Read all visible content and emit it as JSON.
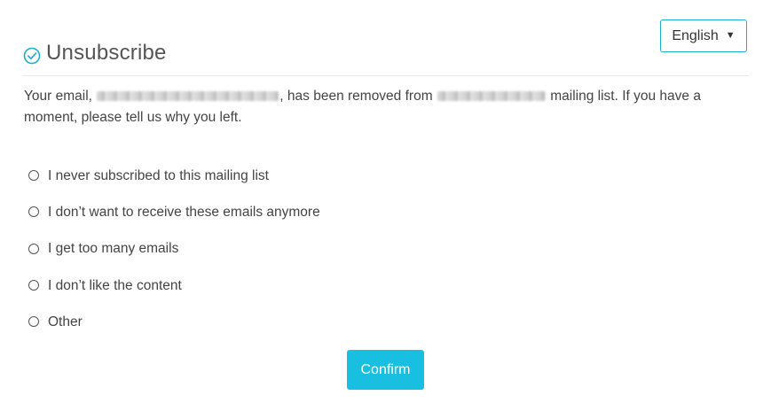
{
  "language": {
    "selected": "English",
    "caret_icon": "caret-down-icon"
  },
  "header": {
    "icon": "check-circle-icon",
    "icon_color": "#1bb0c9",
    "title": "Unsubscribe"
  },
  "message": {
    "part1": "Your email,",
    "part2": ", has been removed from",
    "part3": "mailing list. If you have a moment, please tell us why you left."
  },
  "reasons": [
    "I never subscribed to this mailing list",
    "I don’t want to receive these emails anymore",
    "I get too many emails",
    "I don’t like the content",
    "Other"
  ],
  "confirm": {
    "label": "Confirm",
    "color": "#19bfe0"
  }
}
